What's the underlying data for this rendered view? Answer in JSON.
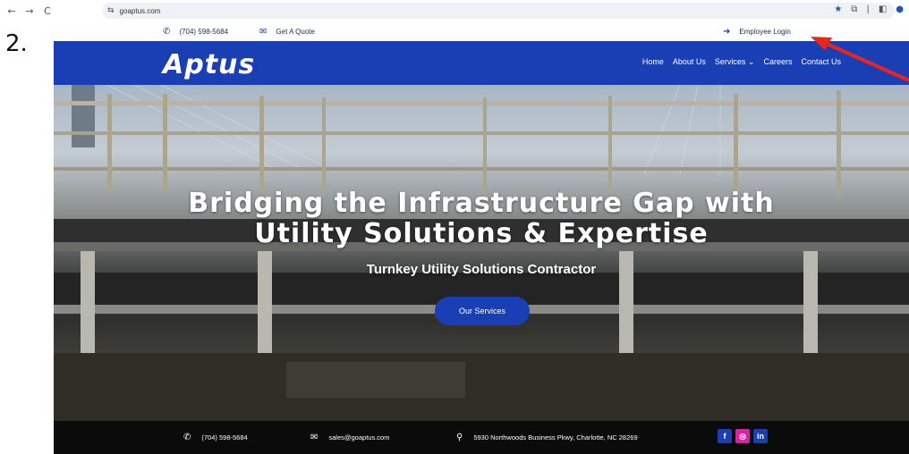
{
  "step_label": "2.",
  "browser": {
    "back_icon": "←",
    "forward_icon": "→",
    "reload_icon": "C",
    "site_info_icon": "⇆",
    "url": "goaptus.com"
  },
  "topbar": {
    "phone": "(704) 598-5684",
    "quote": "Get A Quote",
    "login": "Employee Login"
  },
  "header": {
    "logo": "Aptus",
    "nav": {
      "home": "Home",
      "about": "About Us",
      "services": "Services ⌄",
      "careers": "Careers",
      "contact": "Contact Us"
    }
  },
  "hero": {
    "title_line1": "Bridging the Infrastructure Gap with",
    "title_line2": "Utility Solutions & Expertise",
    "subtitle": "Turnkey Utility Solutions Contractor",
    "button": "Our Services"
  },
  "footer": {
    "phone": "(704) 598-5684",
    "email": "sales@goaptus.com",
    "address": "5930 Northwoods Business Pkwy, Charlotte, NC 28269",
    "facebook": "f",
    "instagram": "◎",
    "linkedin": "in"
  },
  "colors": {
    "brand_blue": "#1a3fb4",
    "footer_black": "#0b0b0b",
    "annotation_red": "#e8261c"
  }
}
